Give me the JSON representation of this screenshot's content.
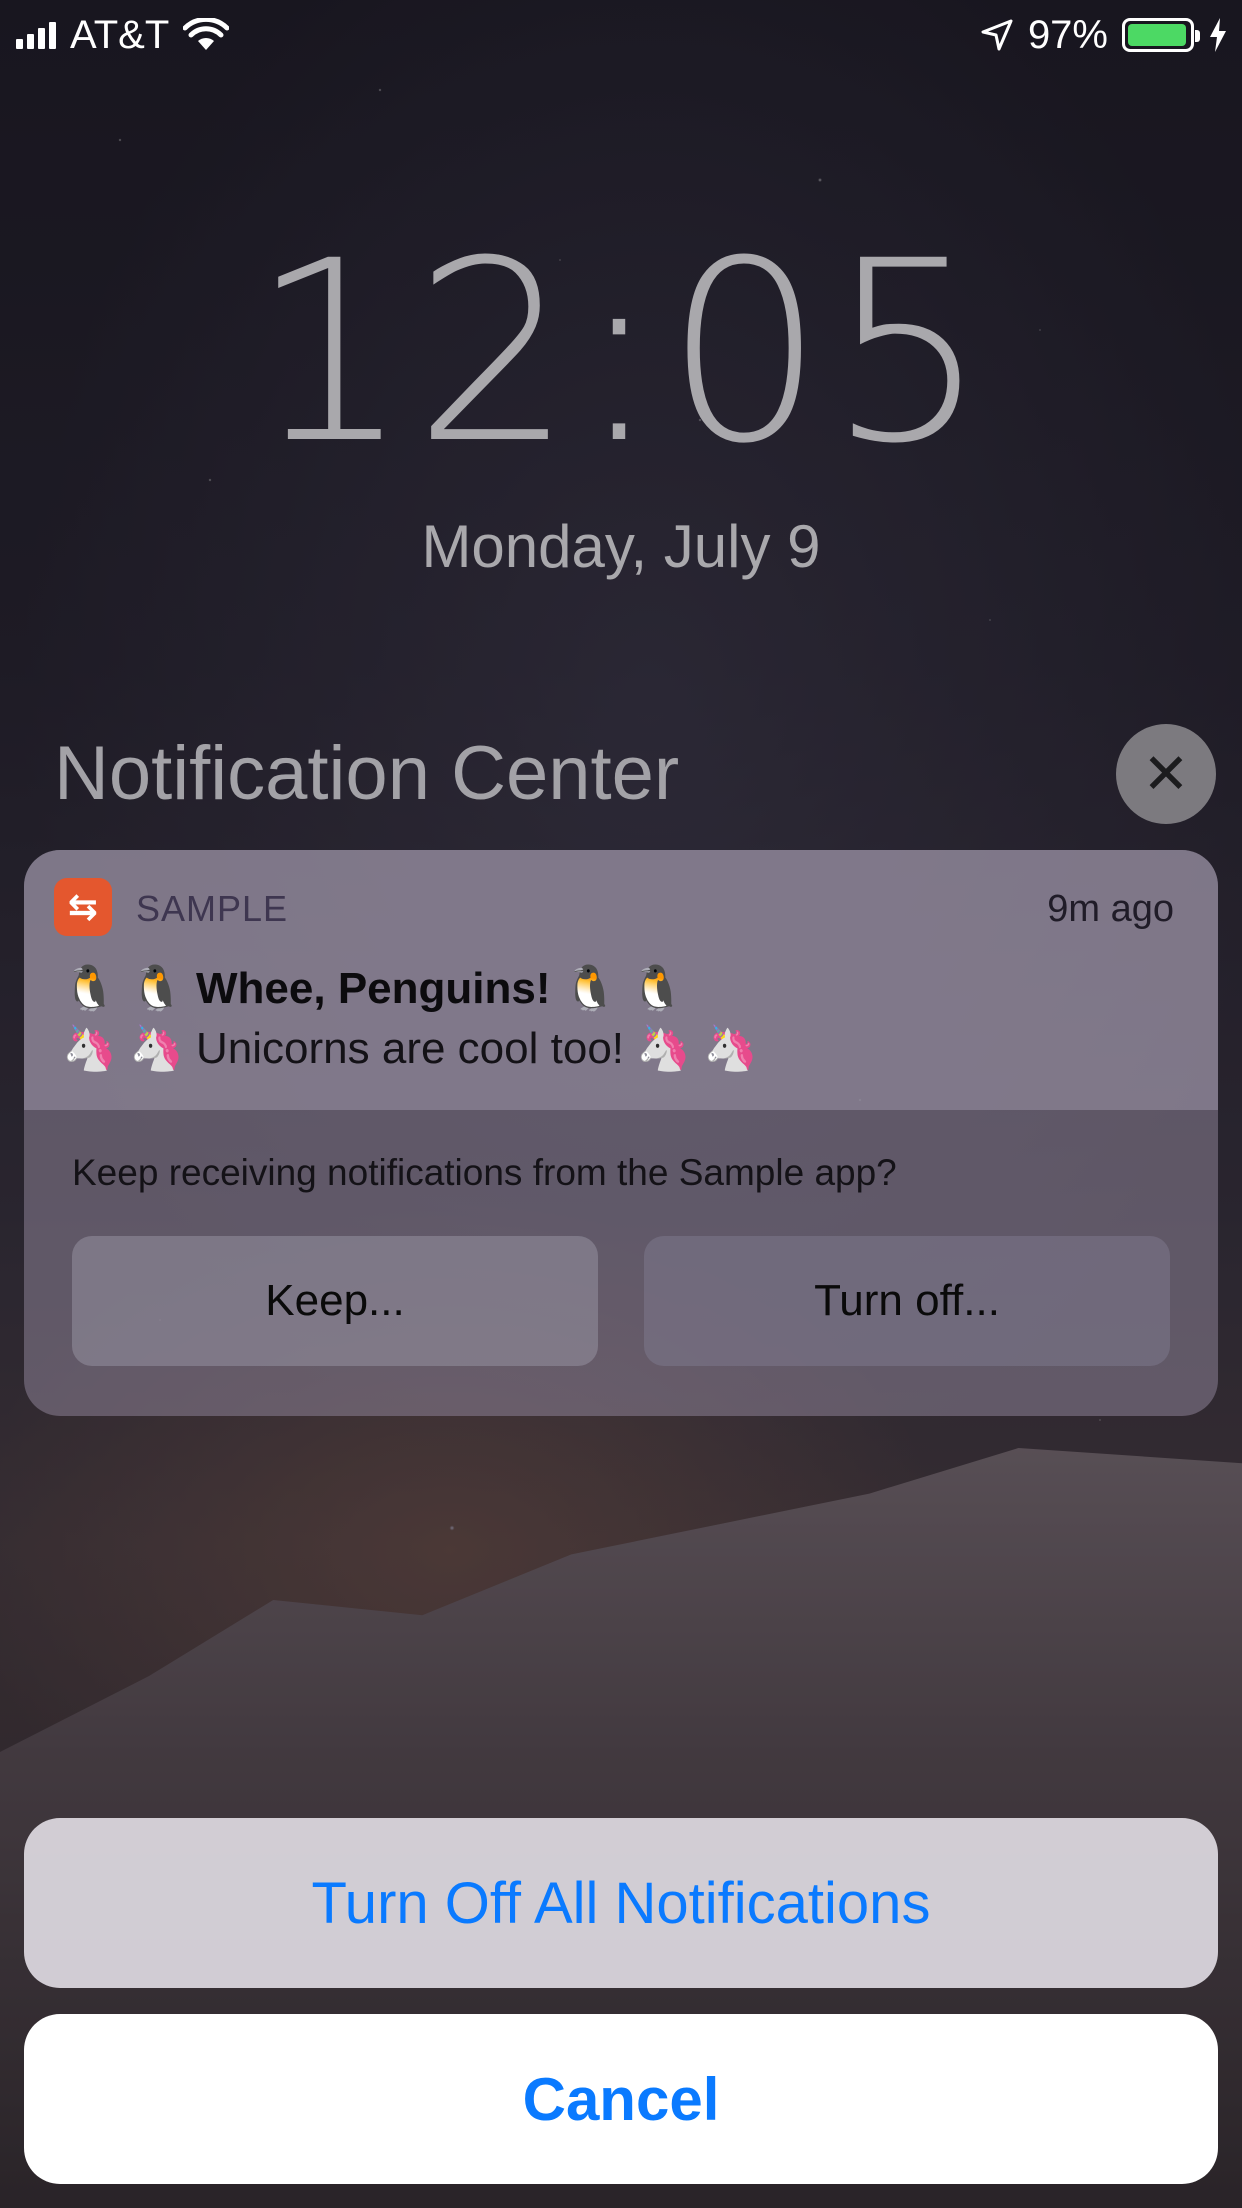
{
  "status_bar": {
    "carrier": "AT&T",
    "battery_percent": "97%",
    "battery_level": 0.97,
    "icons": [
      "signal-icon",
      "wifi-icon",
      "location-arrow-icon",
      "battery-icon",
      "charging-bolt-icon"
    ]
  },
  "lock_screen": {
    "time": "12:05",
    "date": "Monday, July 9"
  },
  "notification_center": {
    "title": "Notification Center",
    "close_icon": "✕"
  },
  "notification": {
    "app_name": "SAMPLE",
    "time_ago": "9m ago",
    "title": "🐧 🐧 Whee, Penguins! 🐧 🐧",
    "body": "🦄 🦄 Unicorns are cool too! 🦄 🦄",
    "question": "Keep receiving notifications from the Sample app?",
    "keep_label": "Keep...",
    "turn_off_label": "Turn off..."
  },
  "action_sheet": {
    "turn_off_all_label": "Turn Off All Notifications",
    "cancel_label": "Cancel"
  },
  "colors": {
    "accent": "#0a7aff",
    "battery": "#4cd964",
    "app_icon": "#e4572e"
  }
}
